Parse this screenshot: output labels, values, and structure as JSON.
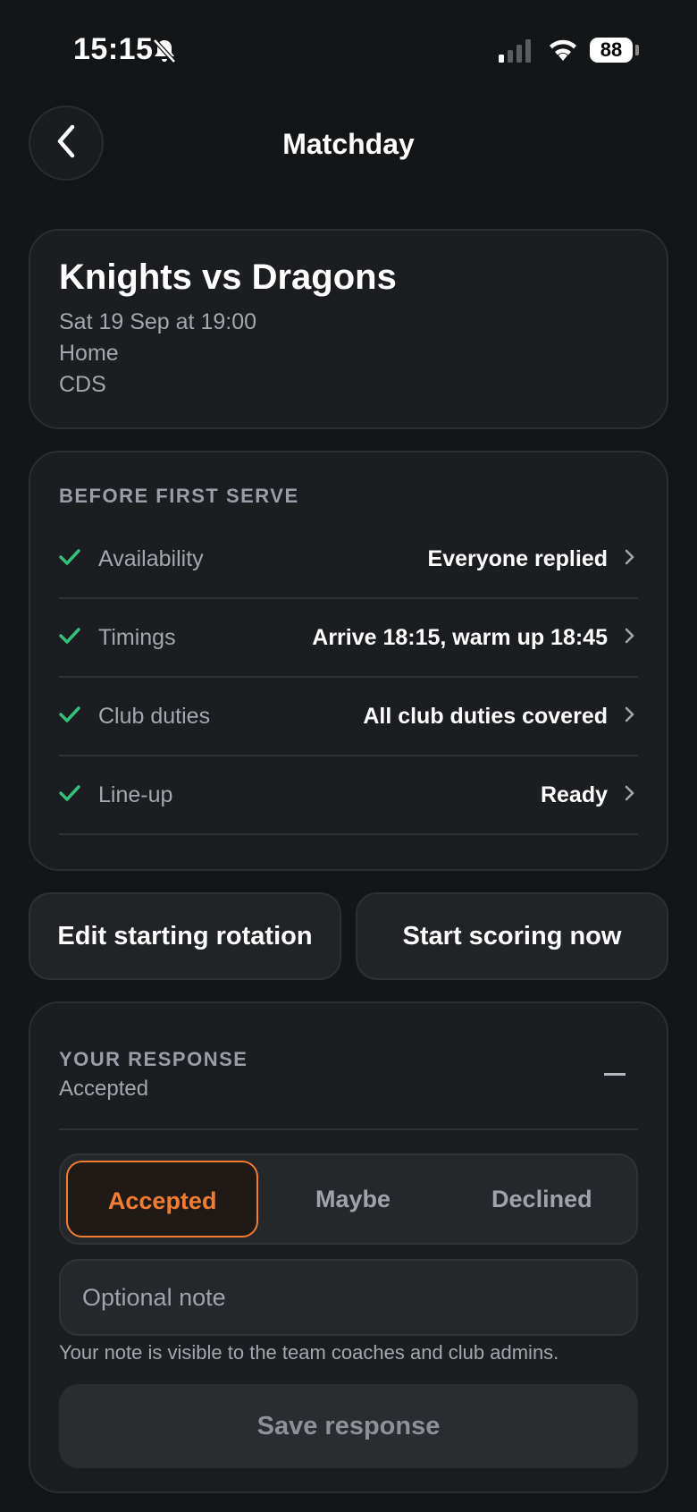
{
  "status_bar": {
    "time": "15:15",
    "battery": "88"
  },
  "nav": {
    "title": "Matchday"
  },
  "match": {
    "title": "Knights vs Dragons",
    "datetime": "Sat 19 Sep at 19:00",
    "venue": "Home",
    "location": "CDS"
  },
  "checklist": {
    "heading": "BEFORE FIRST SERVE",
    "items": [
      {
        "label": "Availability",
        "value": "Everyone replied"
      },
      {
        "label": "Timings",
        "value": "Arrive 18:15, warm up 18:45"
      },
      {
        "label": "Club duties",
        "value": "All club duties covered"
      },
      {
        "label": "Line-up",
        "value": "Ready"
      }
    ]
  },
  "actions": {
    "edit_rotation": "Edit starting rotation",
    "start_scoring": "Start scoring now"
  },
  "response": {
    "heading": "YOUR RESPONSE",
    "status": "Accepted",
    "options": [
      "Accepted",
      "Maybe",
      "Declined"
    ],
    "selected": "Accepted",
    "note_placeholder": "Optional note",
    "note_help": "Your note is visible to the team coaches and club admins.",
    "save_label": "Save response"
  },
  "colors": {
    "accent": "#f27c2f",
    "check": "#35c07a",
    "background": "#141517"
  }
}
